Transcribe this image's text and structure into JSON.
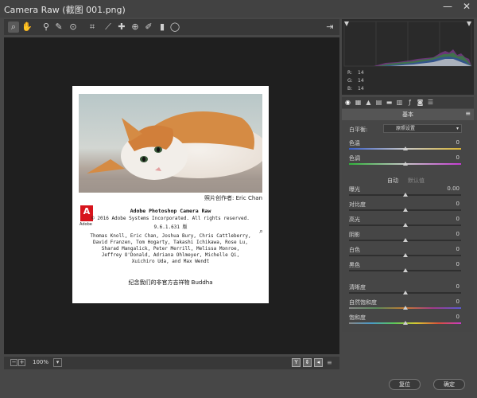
{
  "window": {
    "title": "Camera Raw (截图 001.png)",
    "minimize": "—",
    "close": "✕"
  },
  "toolbar": {
    "tools": [
      "zoom-icon",
      "hand-icon",
      "white-balance-icon",
      "color-sampler-icon",
      "target-adjust-icon",
      "crop-icon",
      "straighten-icon",
      "spot-removal-icon",
      "red-eye-icon",
      "adjustment-brush-icon",
      "graduated-filter-icon",
      "radial-filter-icon"
    ],
    "export_icon": "export-icon"
  },
  "splash": {
    "credit": "照片创作者: Eric Chan",
    "adobe_logo": "A",
    "adobe_word": "Adobe",
    "title": "Adobe Photoshop Camera Raw",
    "copyright": "© 2016 Adobe Systems Incorporated. All rights reserved.",
    "version": "9.6.1.631 版",
    "credits_lines": [
      "Thomas Knoll, Eric Chan, Joshua Bury, Chris Cattleberry,",
      "David Franzen, Tom Hogarty, Takashi Ichikawa, Rose Lu,",
      "Sharad Mangalick, Peter Merrill, Melissa Monroe,",
      "Jeffrey O'Donald, Adriana Ohlmeyer, Michelle Qi,",
      "Xuichiro Uda, and Max Wendt"
    ],
    "tagline": "纪念我们的非官方吉祥物 Buddha"
  },
  "bottombar": {
    "zoom_minus": "−",
    "zoom_plus": "+",
    "zoom_value": "100%",
    "zoom_dropdown": "▾",
    "view_y": "Y",
    "view_toggle": "⇕",
    "view_swap": "◂"
  },
  "histogram": {
    "r_label": "R:",
    "r_value": "14",
    "g_label": "G:",
    "g_value": "14",
    "b_label": "B:",
    "b_value": "14"
  },
  "panel": {
    "title": "基本",
    "menu": "≡",
    "tabs": [
      "basic-icon",
      "tone-curve-icon",
      "detail-icon",
      "hsl-icon",
      "split-toning-icon",
      "lens-corrections-icon",
      "effects-icon",
      "camera-calibration-icon",
      "presets-icon"
    ],
    "white_balance": {
      "label": "白平衡:",
      "value": "原照设置"
    },
    "auto_label": "自动",
    "default_label": "默认值",
    "sliders": [
      {
        "label": "色温",
        "value": "0",
        "level": 0.5
      },
      {
        "label": "色调",
        "value": "0",
        "level": 0.5
      },
      {
        "label": "曝光",
        "value": "0.00",
        "level": 0.5
      },
      {
        "label": "对比度",
        "value": "0",
        "level": 0.5
      },
      {
        "label": "高光",
        "value": "0",
        "level": 0.5
      },
      {
        "label": "阴影",
        "value": "0",
        "level": 0.5
      },
      {
        "label": "白色",
        "value": "0",
        "level": 0.5
      },
      {
        "label": "黑色",
        "value": "0",
        "level": 0.5
      },
      {
        "label": "清晰度",
        "value": "0",
        "level": 0.5
      },
      {
        "label": "自然饱和度",
        "value": "0",
        "level": 0.5
      },
      {
        "label": "饱和度",
        "value": "0",
        "level": 0.5
      }
    ]
  },
  "footer": {
    "reset_label": "复位",
    "ok_label": "确定"
  }
}
